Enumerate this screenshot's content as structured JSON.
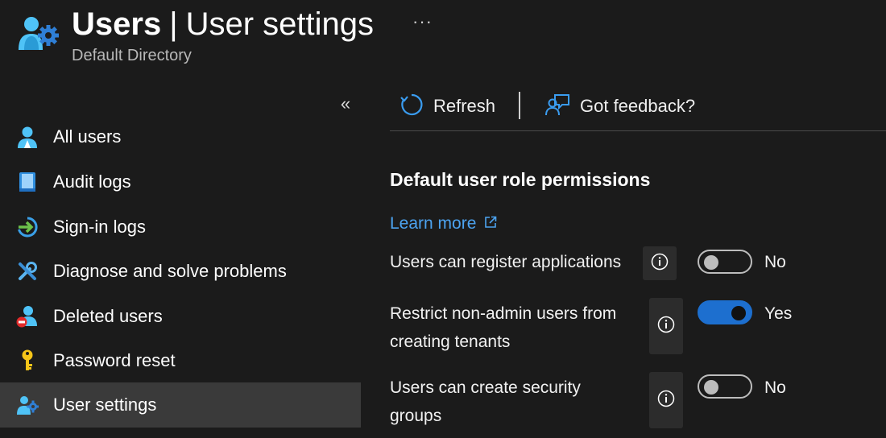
{
  "header": {
    "title_main": "Users",
    "title_sep": "|",
    "title_page": "User settings",
    "more_label": "···",
    "subtitle": "Default Directory",
    "icon": "users-gear-icon"
  },
  "sidebar": {
    "collapse_label": "«",
    "items": [
      {
        "label": "All users",
        "icon": "user-icon"
      },
      {
        "label": "Audit logs",
        "icon": "book-icon"
      },
      {
        "label": "Sign-in logs",
        "icon": "sign-in-icon"
      },
      {
        "label": "Diagnose and solve problems",
        "icon": "wrench-icon"
      },
      {
        "label": "Deleted users",
        "icon": "deleted-user-icon"
      },
      {
        "label": "Password reset",
        "icon": "key-icon"
      },
      {
        "label": "User settings",
        "icon": "users-gear-icon",
        "selected": true
      }
    ]
  },
  "toolbar": {
    "refresh_label": "Refresh",
    "feedback_label": "Got feedback?"
  },
  "content": {
    "section_title": "Default user role permissions",
    "learn_more": "Learn more",
    "settings": [
      {
        "label": "Users can register applications",
        "value": "No",
        "on": false
      },
      {
        "label_line1": "Restrict non-admin users from",
        "label_line2": "creating tenants",
        "value": "Yes",
        "on": true
      },
      {
        "label_line1": "Users can create security",
        "label_line2": "groups",
        "value": "No",
        "on": false
      }
    ]
  },
  "colors": {
    "background": "#1b1b1b",
    "selected_item": "#3a3a3a",
    "link": "#4ca3f0",
    "toggle_on": "#1d6fcf"
  }
}
